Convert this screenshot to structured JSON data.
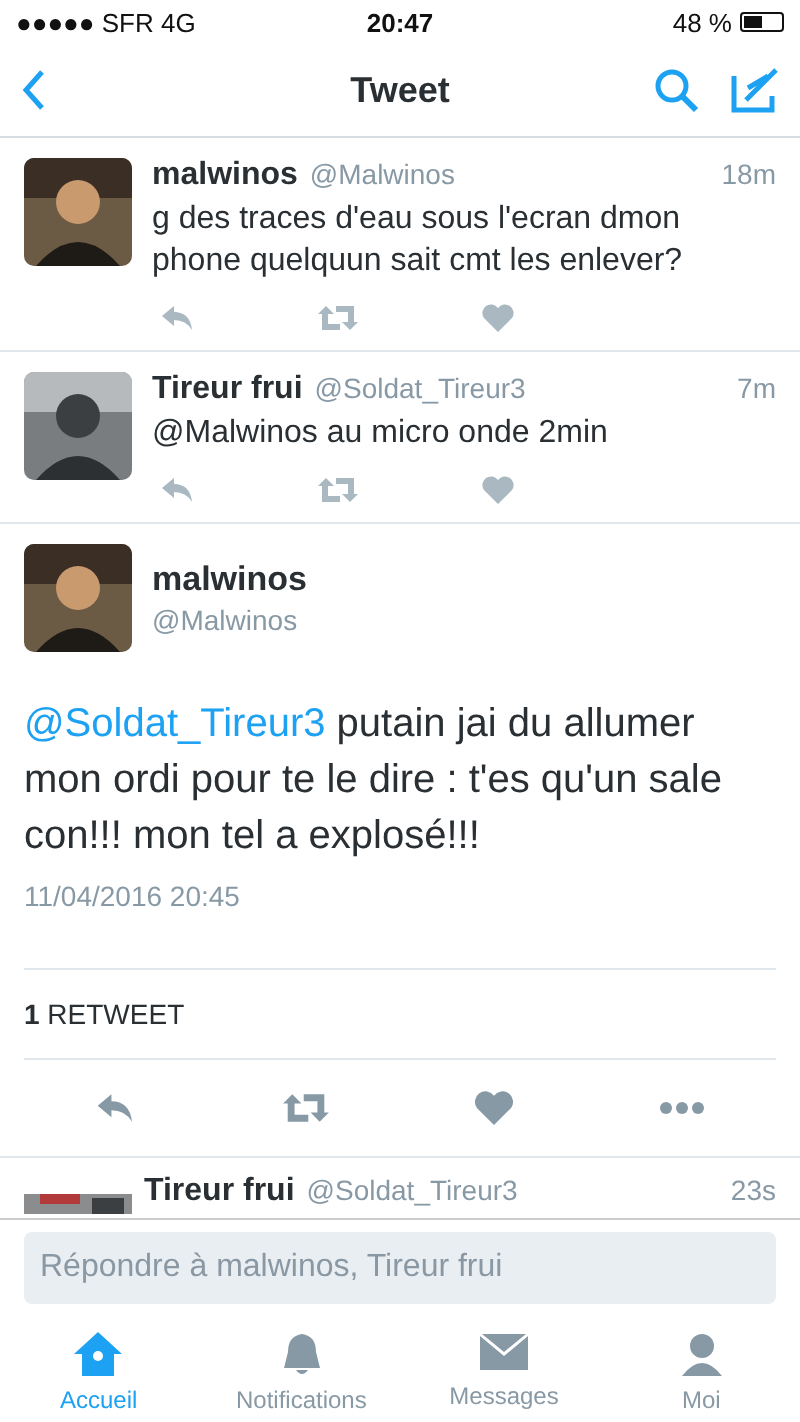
{
  "status_bar": {
    "carrier": "●●●●● SFR  4G",
    "time": "20:47",
    "battery": "48 %"
  },
  "nav": {
    "title": "Tweet"
  },
  "replies_above": [
    {
      "name": "malwinos",
      "handle": "@Malwinos",
      "time": "18m",
      "text": "g des traces d'eau sous l'ecran dmon phone quelquun sait cmt les enlever?"
    },
    {
      "name": "Tireur frui",
      "handle": "@Soldat_Tireur3",
      "time": "7m",
      "text": "@Malwinos au micro onde 2min"
    }
  ],
  "main_tweet": {
    "name": "malwinos",
    "handle": "@Malwinos",
    "mention": "@Soldat_Tireur3",
    "text": "putain jai du allumer mon ordi pour te le dire : t'es qu'un sale con!!! mon tel a explosé!!!",
    "timestamp": "11/04/2016 20:45",
    "retweets": "**1** RETWEET"
  },
  "next_reply": {
    "name": "Tireur frui",
    "handle": "@Soldat_Tireur3",
    "time": "23s"
  },
  "reply_field": {
    "placeholder": "Répondre à malwinos, Tireur frui"
  },
  "tabs": [
    {
      "label": "Accueil",
      "kind": "home",
      "selected": true
    },
    {
      "label": "Notifications",
      "kind": "bell",
      "selected": false
    },
    {
      "label": "Messages",
      "kind": "mail",
      "selected": false
    },
    {
      "label": "Moi",
      "kind": "person",
      "selected": false
    }
  ]
}
